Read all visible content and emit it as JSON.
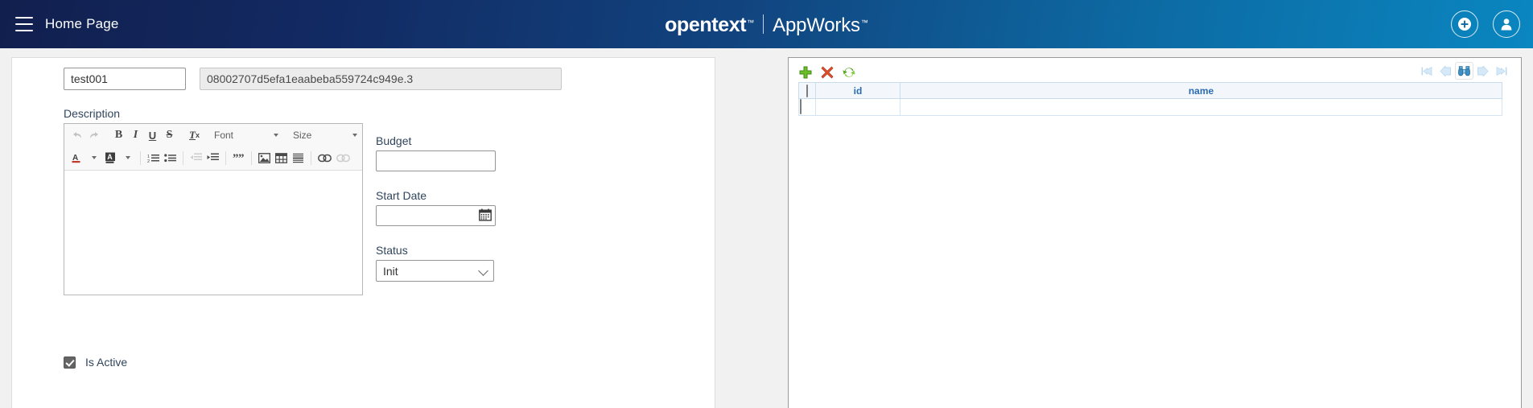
{
  "appbar": {
    "menu_icon": "hamburger-icon",
    "title": "Home Page",
    "brand_primary": "opentext",
    "brand_tm": "™",
    "brand_secondary": "AppWorks",
    "brand_secondary_tm": "™",
    "add_icon": "plus-circle-icon",
    "user_icon": "user-avatar-icon",
    "gradient_start": "#111f4e",
    "gradient_end": "#0a86c0"
  },
  "form": {
    "name_value": "test001",
    "name_placeholder": "",
    "id_value": "08002707d5efa1eaabeba559724c949e.3",
    "description_label": "Description",
    "description_value": "",
    "editor": {
      "row1": [
        {
          "name": "undo-icon",
          "glyph": "↶",
          "disabled": true
        },
        {
          "name": "redo-icon",
          "glyph": "↷",
          "disabled": true
        },
        {
          "name": "bold-icon",
          "glyph": "B",
          "disabled": false
        },
        {
          "name": "italic-icon",
          "glyph": "I",
          "disabled": false
        },
        {
          "name": "underline-icon",
          "glyph": "U",
          "disabled": false
        },
        {
          "name": "strikethrough-icon",
          "glyph": "S",
          "disabled": false
        },
        {
          "name": "remove-format-icon",
          "glyph": "Tx",
          "disabled": false
        }
      ],
      "font_label": "Font",
      "size_label": "Size",
      "row2": [
        {
          "name": "text-color-icon",
          "disabled": false
        },
        {
          "name": "background-color-icon",
          "disabled": false
        },
        {
          "name": "numbered-list-icon",
          "disabled": false
        },
        {
          "name": "bulleted-list-icon",
          "disabled": false
        },
        {
          "name": "decrease-indent-icon",
          "disabled": true
        },
        {
          "name": "increase-indent-icon",
          "disabled": false
        },
        {
          "name": "blockquote-icon",
          "disabled": false
        },
        {
          "name": "image-icon",
          "disabled": false
        },
        {
          "name": "table-icon",
          "disabled": false
        },
        {
          "name": "horizontal-rule-icon",
          "disabled": false
        },
        {
          "name": "link-icon",
          "disabled": false
        },
        {
          "name": "unlink-icon",
          "disabled": true
        }
      ]
    },
    "budget_label": "Budget",
    "budget_value": "",
    "start_date_label": "Start Date",
    "start_date_value": "",
    "calendar_icon": "calendar-icon",
    "status_label": "Status",
    "status_value": "Init",
    "status_options": [
      "Init"
    ],
    "is_active_label": "Is Active",
    "is_active_checked": true
  },
  "grid": {
    "toolbar": [
      {
        "name": "add-row-icon",
        "color": "#53a81f"
      },
      {
        "name": "delete-row-icon",
        "color": "#d94d2a"
      },
      {
        "name": "refresh-icon",
        "color": "#5aa829"
      }
    ],
    "pager": [
      {
        "name": "first-page-icon",
        "active": false
      },
      {
        "name": "previous-page-icon",
        "active": false
      },
      {
        "name": "search-binoculars-icon",
        "active": true
      },
      {
        "name": "next-page-icon",
        "active": false
      },
      {
        "name": "last-page-icon",
        "active": false
      }
    ],
    "columns": [
      "",
      "id",
      "name"
    ],
    "header_select_all": false,
    "rows": [
      {
        "selected": false,
        "id": "",
        "name": ""
      }
    ]
  }
}
